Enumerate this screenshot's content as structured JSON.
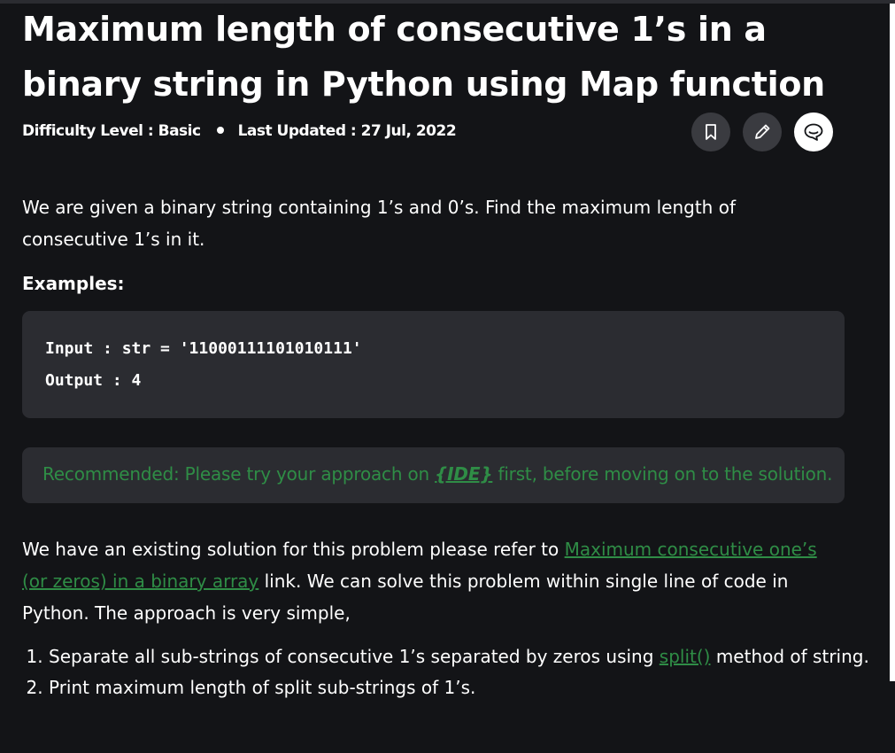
{
  "article": {
    "title": "Maximum length of consecutive 1’s in a binary string in Python using Map function",
    "difficulty": "Difficulty Level : Basic",
    "last_updated": "Last Updated : 27 Jul, 2022"
  },
  "actions": {
    "bookmark_icon": "bookmark-icon",
    "edit_icon": "pencil-icon",
    "comment_icon": "comment-icon"
  },
  "content": {
    "intro": "We are given a binary string containing 1’s and 0’s. Find the maximum length of consecutive 1’s in it.",
    "examples_label": "Examples:",
    "code_input": "Input : str = '11000111101010111'",
    "code_output": "Output : 4",
    "recommended_prefix": "Recommended: Please try your approach on ",
    "recommended_link": "{IDE}",
    "recommended_suffix": " first, before moving on to the solution.",
    "solution_prefix": "We have an existing solution for this problem please refer to ",
    "solution_link": "Maximum consecutive one’s (or zeros) in a binary array",
    "solution_suffix": " link. We can solve this problem within single line of code in Python. The approach is very simple,",
    "step1_prefix": "Separate all sub-strings of consecutive 1’s separated by zeros using ",
    "step1_link": "split()",
    "step1_suffix": " method of string.",
    "step2": "Print maximum length of split sub-strings of 1’s."
  },
  "colors": {
    "background": "#131417",
    "panel": "#2b2c31",
    "link_green": "#2f8d46",
    "text": "#ffffff"
  }
}
